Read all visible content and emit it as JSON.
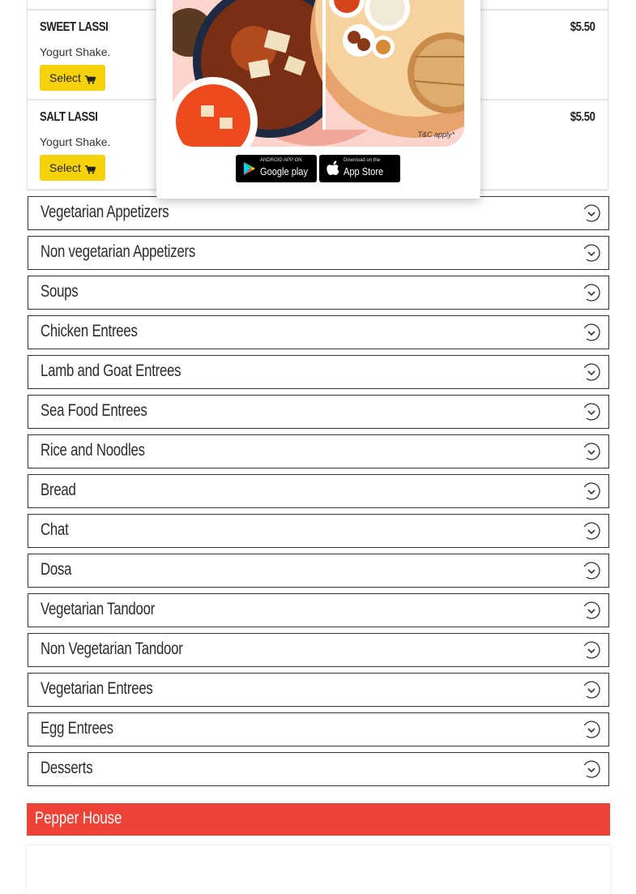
{
  "menu_items": [
    {
      "name": "SWEET LASSI",
      "description": "Yogurt Shake.",
      "price": "$5.50",
      "select_label": "Select"
    },
    {
      "name": "SALT LASSI",
      "description": "Yogurt Shake.",
      "price": "$5.50",
      "select_label": "Select"
    }
  ],
  "categories": [
    "Vegetarian Appetizers",
    "Non vegetarian Appetizers",
    "Soups",
    "Chicken Entrees",
    "Lamb and Goat Entrees",
    "Sea Food Entrees",
    "Rice and Noodles",
    "Bread",
    "Chat",
    "Dosa",
    "Vegetarian Tandoor",
    "Non Vegetarian Tandoor",
    "Vegetarian Entrees",
    "Egg Entrees",
    "Desserts"
  ],
  "restaurant": {
    "name": "Pepper House"
  },
  "popup": {
    "terms": "T&C apply*",
    "google_play": {
      "small": "ANDROID APP ON",
      "big": "Google play"
    },
    "app_store": {
      "small": "Download on the",
      "big": "App Store"
    }
  },
  "colors": {
    "accent": "#ee4236",
    "button": "#f5d20a",
    "promo_bg": "#fbd4cd"
  }
}
